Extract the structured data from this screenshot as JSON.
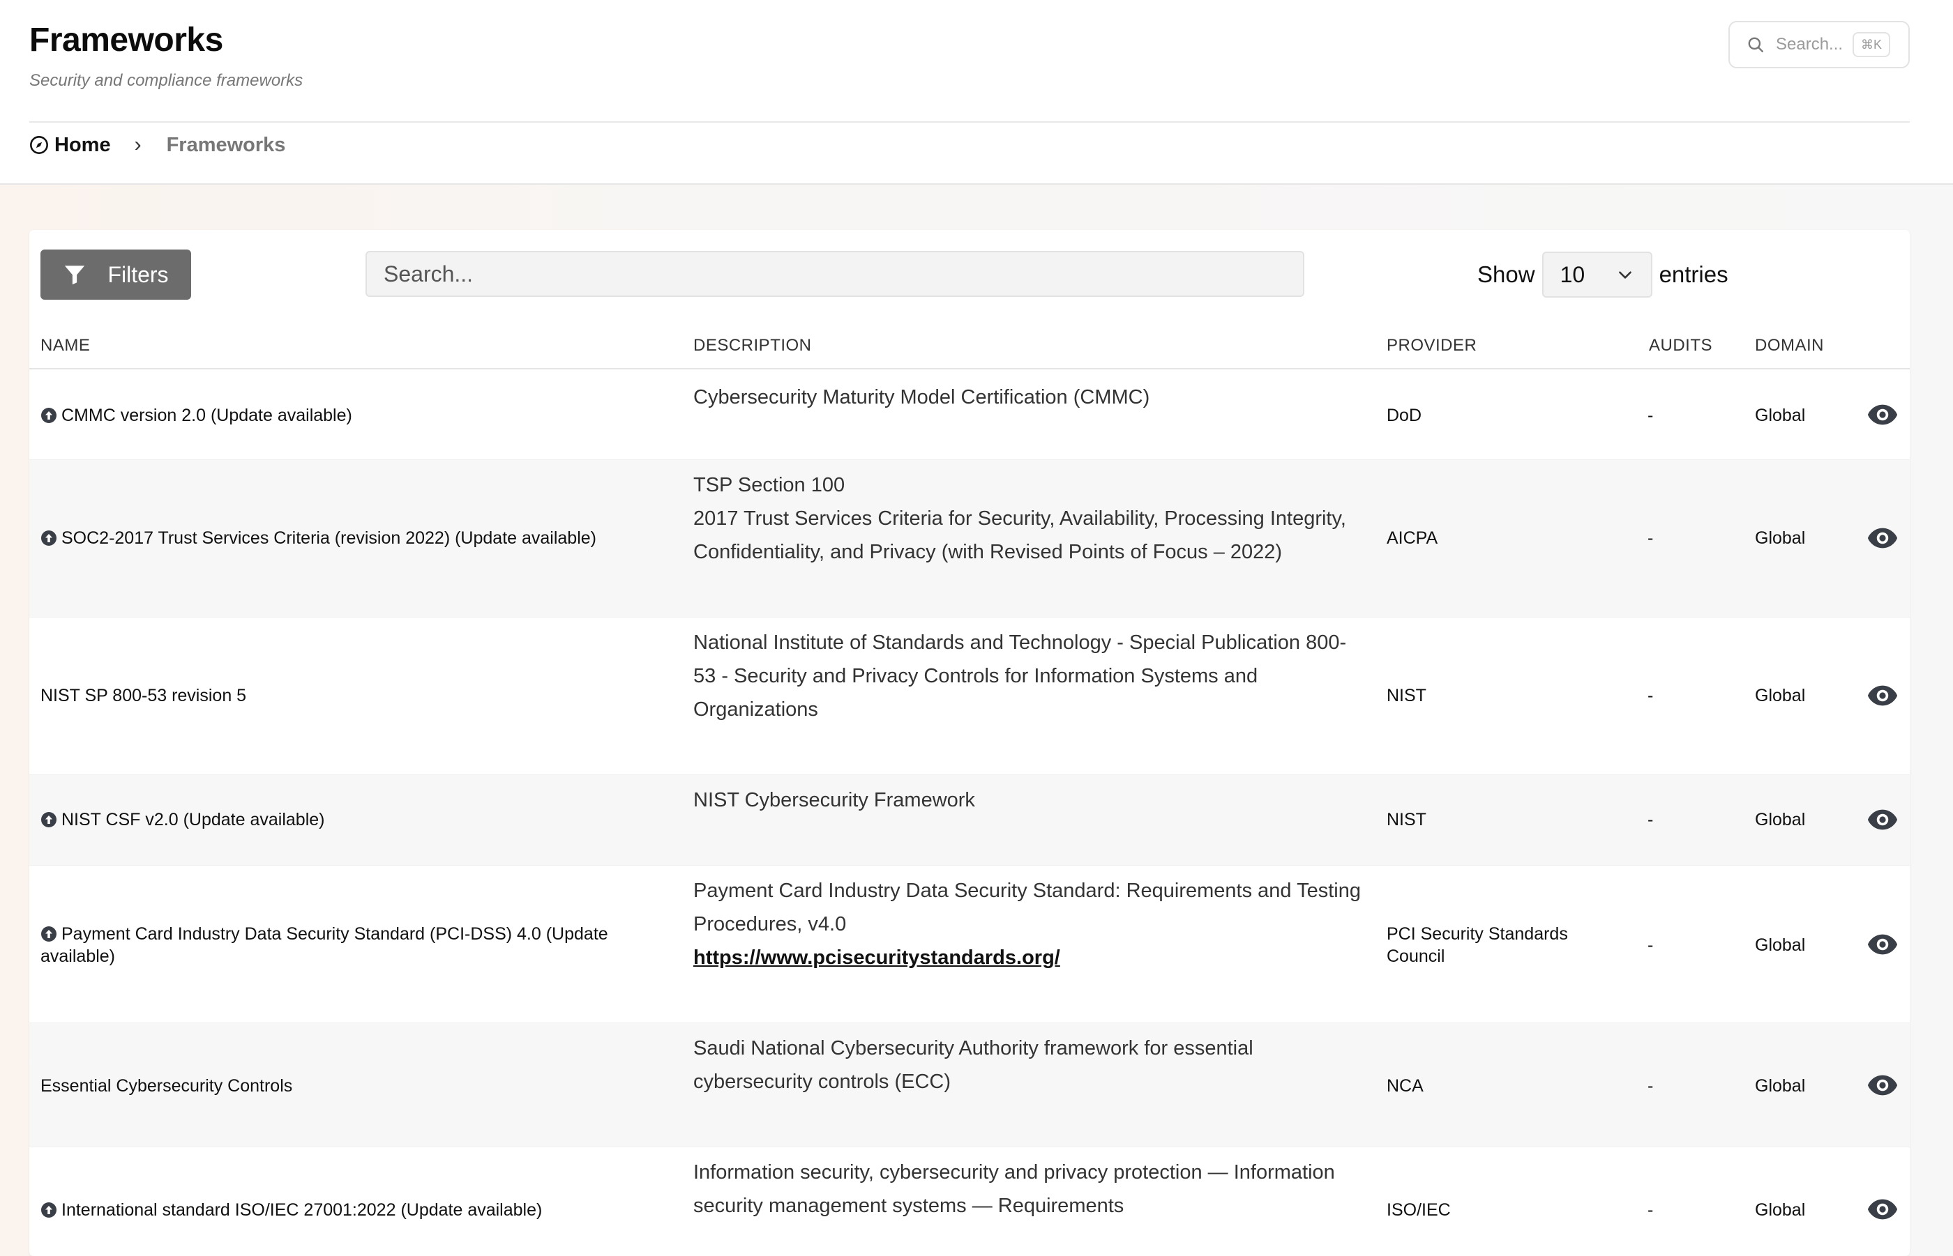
{
  "header": {
    "title": "Frameworks",
    "subtitle": "Security and compliance frameworks",
    "search_placeholder": "Search...",
    "search_shortcut": "⌘K"
  },
  "breadcrumb": {
    "home": "Home",
    "separator": "›",
    "current": "Frameworks"
  },
  "toolbar": {
    "filters_label": "Filters",
    "search_placeholder": "Search...",
    "show_label": "Show",
    "entries_value": "10",
    "entries_label": "entries"
  },
  "table": {
    "columns": {
      "name": "NAME",
      "description": "DESCRIPTION",
      "provider": "PROVIDER",
      "audits": "AUDITS",
      "domain": "DOMAIN"
    },
    "rows": [
      {
        "name": "CMMC version 2.0 (Update available)",
        "update": true,
        "description": [
          "Cybersecurity Maturity Model Certification (CMMC)"
        ],
        "provider": "DoD",
        "audits": "-",
        "domain": "Global"
      },
      {
        "name": "SOC2-2017 Trust Services Criteria (revision 2022) (Update available)",
        "update": true,
        "description": [
          "TSP Section 100",
          "2017 Trust Services Criteria for Security, Availability, Processing Integrity,",
          "Confidentiality, and Privacy (with Revised Points of Focus – 2022)"
        ],
        "provider": "AICPA",
        "audits": "-",
        "domain": "Global"
      },
      {
        "name": "NIST SP 800-53 revision 5",
        "update": false,
        "description": [
          "National Institute of Standards and Technology - Special Publication 800-",
          "53 - Security and Privacy Controls for Information Systems and",
          "Organizations"
        ],
        "provider": "NIST",
        "audits": "-",
        "domain": "Global"
      },
      {
        "name": "NIST CSF v2.0 (Update available)",
        "update": true,
        "description": [
          "NIST Cybersecurity Framework"
        ],
        "provider": "NIST",
        "audits": "-",
        "domain": "Global"
      },
      {
        "name": "Payment Card Industry Data Security Standard (PCI-DSS) 4.0 (Update available)",
        "update": true,
        "description": [
          "Payment Card Industry Data Security Standard: Requirements and Testing",
          "Procedures, v4.0"
        ],
        "link": "https://www.pcisecuritystandards.org/",
        "provider": "PCI Security Standards Council",
        "audits": "-",
        "domain": "Global"
      },
      {
        "name": "Essential Cybersecurity Controls",
        "update": false,
        "description": [
          "Saudi National Cybersecurity Authority framework for essential",
          "cybersecurity controls (ECC)"
        ],
        "provider": "NCA",
        "audits": "-",
        "domain": "Global"
      },
      {
        "name": "International standard ISO/IEC 27001:2022 (Update available)",
        "update": true,
        "description": [
          "Information security, cybersecurity and privacy protection — Information",
          "security management systems — Requirements"
        ],
        "provider": "ISO/IEC",
        "audits": "-",
        "domain": "Global"
      }
    ]
  },
  "colors": {
    "filters_button": "#6c6c6c",
    "row_alt": "#f7f7f7",
    "icon": "#3a3f47"
  },
  "icons": {
    "header_search": "search-icon",
    "home": "compass-icon",
    "filters": "funnel-icon",
    "select": "chevron-down-icon",
    "update": "arrow-up-circle-icon",
    "view": "eye-icon"
  }
}
